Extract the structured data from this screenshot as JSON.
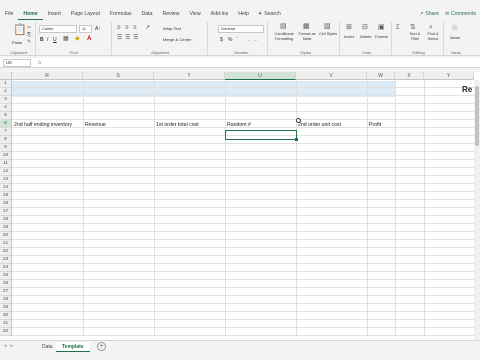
{
  "menu": {
    "tabs": [
      "File",
      "Home",
      "Insert",
      "Page Layout",
      "Formulas",
      "Data",
      "Review",
      "View",
      "Add-ins",
      "Help"
    ],
    "active_tab": "Home",
    "search_label": "Search",
    "share_label": "Share",
    "comments_label": "Comments"
  },
  "ribbon": {
    "clipboard": {
      "label": "Clipboard",
      "paste": "Paste"
    },
    "font": {
      "label": "Font",
      "name": "Calibri",
      "size": "11",
      "bold": "B",
      "italic": "I",
      "underline": "U"
    },
    "alignment": {
      "label": "Alignment",
      "wrap_text": "Wrap Text",
      "merge_center": "Merge & Center"
    },
    "number": {
      "label": "Number",
      "format": "General",
      "currency": "$",
      "percent": "%"
    },
    "styles": {
      "label": "Styles",
      "conditional": "Conditional Formatting",
      "format_table": "Format as Table",
      "cell_styles": "Cell Styles"
    },
    "cells": {
      "label": "Cells",
      "insert": "Insert",
      "delete": "Delete",
      "format": "Format"
    },
    "editing": {
      "label": "Editing",
      "sort_filter": "Sort & Filter",
      "find_select": "Find & Select"
    },
    "ideas": {
      "label": "Ideas",
      "ideas": "Ideas"
    }
  },
  "formula_bar": {
    "name_box": "U6",
    "fx": "fx",
    "value": ""
  },
  "grid": {
    "columns": [
      "R",
      "S",
      "T",
      "U",
      "V",
      "W",
      "X",
      "Y"
    ],
    "selected_column": "U",
    "rows": [
      "1",
      "2",
      "3",
      "4",
      "5",
      "6",
      "7",
      "8",
      "9",
      "10",
      "11",
      "12",
      "13",
      "14",
      "15",
      "16",
      "17",
      "18",
      "19",
      "20",
      "21",
      "22",
      "23",
      "24",
      "25",
      "26",
      "27",
      "28",
      "29",
      "30",
      "31",
      "32"
    ],
    "selected_row": "6",
    "title_partial": "Re",
    "row5": {
      "R": "2nd half ending inventory",
      "S": "Revenue",
      "T": "1st order total cost",
      "U": "Random #",
      "V": "2nd order unit cost",
      "W": "Profit"
    }
  },
  "sheets": {
    "tabs": [
      "Data",
      "Template"
    ],
    "active": "Template"
  }
}
